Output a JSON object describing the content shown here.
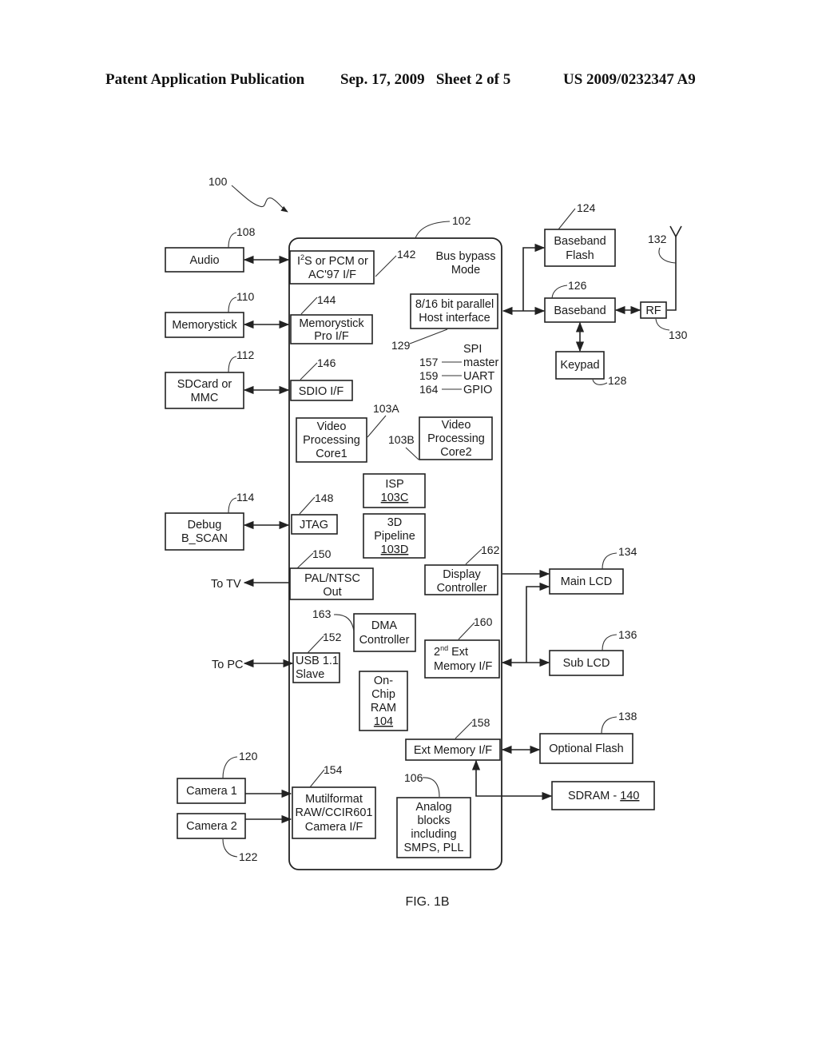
{
  "header": {
    "publication": "Patent Application Publication",
    "date_sheet": "Sep. 17, 2009   Sheet 2 of 5",
    "number": "US 2009/0232347 A9"
  },
  "figure": {
    "caption": "FIG. 1B",
    "system_ref": "100",
    "chip_ref": "102"
  },
  "external": {
    "audio": {
      "label": "Audio",
      "ref": "108"
    },
    "memorystick": {
      "label": "Memorystick",
      "ref": "110"
    },
    "sdcard": {
      "line1": "SDCard or",
      "line2": "MMC",
      "ref": "112"
    },
    "debug": {
      "line1": "Debug",
      "line2": "B_SCAN",
      "ref": "114"
    },
    "to_tv": "To TV",
    "to_pc": "To PC",
    "camera1": {
      "label": "Camera 1",
      "ref": "120"
    },
    "camera2": {
      "label": "Camera 2",
      "ref": "122"
    },
    "baseband_flash": {
      "line1": "Baseband",
      "line2": "Flash",
      "ref": "124"
    },
    "baseband": {
      "label": "Baseband",
      "ref": "126"
    },
    "keypad": {
      "label": "Keypad",
      "ref": "128"
    },
    "rf": {
      "label": "RF",
      "ref": "130"
    },
    "antenna_ref": "132",
    "main_lcd": {
      "label": "Main LCD",
      "ref": "134"
    },
    "sub_lcd": {
      "label": "Sub LCD",
      "ref": "136"
    },
    "optional_flash": {
      "label": "Optional Flash",
      "ref": "138"
    },
    "sdram": {
      "label": "SDRAM - ",
      "ref": "140"
    }
  },
  "internal": {
    "i2s": {
      "line1a": "I",
      "sup": "2",
      "line1b": "S or PCM or",
      "line2": "AC'97 I/F",
      "ref": "142"
    },
    "bus_bypass": {
      "line1": "Bus bypass",
      "line2": "Mode"
    },
    "host_if": {
      "line1": "8/16 bit parallel",
      "line2": "Host interface",
      "ref": "129"
    },
    "memorystick_if": {
      "line1": "Memorystick",
      "line2": "Pro I/F",
      "ref": "144"
    },
    "spi": {
      "line1": "SPI",
      "line2": "master",
      "ref": "157"
    },
    "uart": {
      "label": "UART",
      "ref": "159"
    },
    "gpio": {
      "label": "GPIO",
      "ref": "164"
    },
    "sdio": {
      "label": "SDIO I/F",
      "ref": "146"
    },
    "vpc1": {
      "line1": "Video",
      "line2": "Processing",
      "line3": "Core1",
      "ref": "103A"
    },
    "vpc2": {
      "line1": "Video",
      "line2": "Processing",
      "line3": "Core2",
      "ref": "103B"
    },
    "isp": {
      "line1": "ISP",
      "ref": "103C"
    },
    "pipeline3d": {
      "line1": "3D",
      "line2": "Pipeline",
      "ref": "103D"
    },
    "jtag": {
      "label": "JTAG",
      "ref": "148"
    },
    "palntsc": {
      "line1": "PAL/NTSC",
      "line2": "Out",
      "ref": "150"
    },
    "display_ctrl": {
      "line1": "Display",
      "line2": "Controller",
      "ref": "162"
    },
    "dma": {
      "line1": "DMA",
      "line2": "Controller",
      "ref": "163"
    },
    "usb": {
      "line1": "USB 1.1",
      "line2": "Slave",
      "ref": "152"
    },
    "ext_mem2": {
      "line1a": "2",
      "sup": "nd",
      "line1b": " Ext",
      "line2": "Memory I/F",
      "ref": "160"
    },
    "onchip_ram": {
      "line1": "On-",
      "line2": "Chip",
      "line3": "RAM",
      "ref": "104"
    },
    "ext_mem": {
      "label": "Ext Memory I/F",
      "ref": "158"
    },
    "camera_if": {
      "line1": "Mutilformat",
      "line2": "RAW/CCIR601",
      "line3": "Camera I/F",
      "ref": "154"
    },
    "analog": {
      "line1": "Analog",
      "line2": "blocks",
      "line3": "including",
      "line4": "SMPS, PLL",
      "ref": "106"
    }
  }
}
